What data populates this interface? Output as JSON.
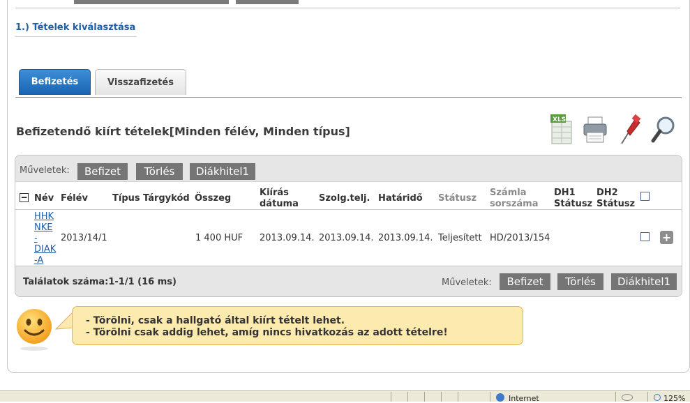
{
  "section": {
    "step_title": "1.) Tételek kiválasztása",
    "title": "Befizetendő kiírt tételek[Minden félév, Minden típus]"
  },
  "tabs": [
    {
      "label": "Befizetés",
      "active": true
    },
    {
      "label": "Visszafizetés",
      "active": false
    }
  ],
  "toolbar_icons": [
    "excel-export-icon",
    "printer-icon",
    "pin-icon",
    "magnifier-icon"
  ],
  "grid": {
    "ops_label": "Műveletek:",
    "buttons": {
      "pay": "Befizet",
      "delete": "Törlés",
      "loan": "Diákhitel1"
    },
    "columns": {
      "nev": "Név",
      "felev": "Félév",
      "tipus": "Típus",
      "targykod": "Tárgykód",
      "osszeg": "Összeg",
      "kiiras_1": "Kiírás",
      "kiiras_2": "dátuma",
      "szolg": "Szolg.telj.",
      "hatarido": "Határidő",
      "statusz": "Státusz",
      "szamla_1": "Számla",
      "szamla_2": "sorszáma",
      "dh1_1": "DH1",
      "dh1_2": "Státusz",
      "dh2_1": "DH2",
      "dh2_2": "Státusz"
    },
    "rows": [
      {
        "nev_lines": [
          "HHK",
          "NKE",
          "-",
          "DIAK",
          "-A"
        ],
        "felev": "2013/14/1",
        "tipus": "",
        "targykod": "",
        "osszeg": "1 400 HUF",
        "kiiras": "2013.09.14.",
        "szolg": "2013.09.14.",
        "hatarido": "2013.09.14.",
        "statusz": "Teljesített",
        "szamla": "HD/2013/154"
      }
    ],
    "results_label": "Találatok száma:1-1/1 (16 ms)"
  },
  "notice": {
    "line1": "- Törölni, csak a hallgató által kiírt tételt lehet.",
    "line2": "- Törölni csak addig lehet, amíg nincs hivatkozás az adott tételre!"
  },
  "statusbar": {
    "zone": "Internet",
    "zoom": "125%"
  },
  "colors": {
    "accent_blue": "#1a64b4",
    "link_blue": "#1f5fa8",
    "button_grey": "#757575",
    "notice_bg": "#fdeaae"
  }
}
